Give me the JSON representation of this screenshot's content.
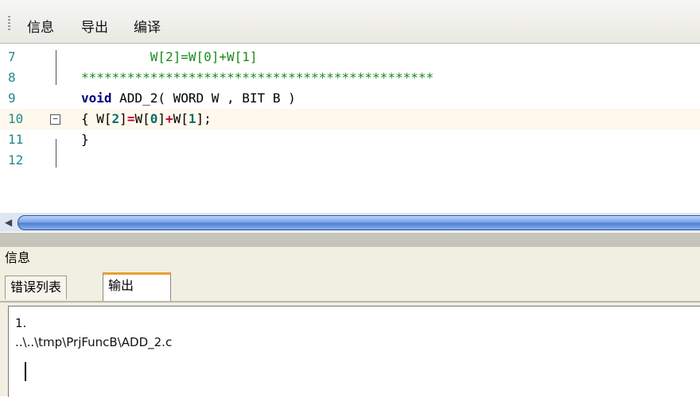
{
  "menu": {
    "items": [
      "信息",
      "导出",
      "编译"
    ]
  },
  "editor": {
    "lines": [
      {
        "num": "7",
        "tokens": [
          {
            "t": "W[2]=W[0]+W[1]",
            "c": "c-green"
          }
        ],
        "indent": "         "
      },
      {
        "num": "8",
        "tokens": [
          {
            "t": "**********************************************",
            "c": "c-green"
          }
        ],
        "indent": ""
      },
      {
        "num": "9",
        "tokens": [
          {
            "t": "void",
            "c": "c-kw"
          },
          {
            "t": " ADD_2( WORD W , BIT B )",
            "c": "c-plain"
          }
        ],
        "indent": ""
      },
      {
        "num": "10",
        "tokens": [
          {
            "t": "{ ",
            "c": "c-plain"
          },
          {
            "t": "W[",
            "c": "c-plain"
          },
          {
            "t": "2",
            "c": "c-num"
          },
          {
            "t": "]",
            "c": "c-plain"
          },
          {
            "t": "=",
            "c": "c-red"
          },
          {
            "t": "W[",
            "c": "c-plain"
          },
          {
            "t": "0",
            "c": "c-num"
          },
          {
            "t": "]",
            "c": "c-plain"
          },
          {
            "t": "+",
            "c": "c-red"
          },
          {
            "t": "W[",
            "c": "c-plain"
          },
          {
            "t": "1",
            "c": "c-num"
          },
          {
            "t": "];",
            "c": "c-plain"
          }
        ],
        "indent": ""
      },
      {
        "num": "11",
        "tokens": [
          {
            "t": "}",
            "c": "c-plain"
          }
        ],
        "indent": ""
      },
      {
        "num": "12",
        "tokens": [],
        "indent": ""
      }
    ]
  },
  "panel": {
    "title": "信息",
    "tabs": [
      "错误列表",
      "输出"
    ],
    "active_tab": 1,
    "output_lines": [
      "1.",
      "..\\..\\tmp\\PrjFuncB\\ADD_2.c"
    ]
  }
}
